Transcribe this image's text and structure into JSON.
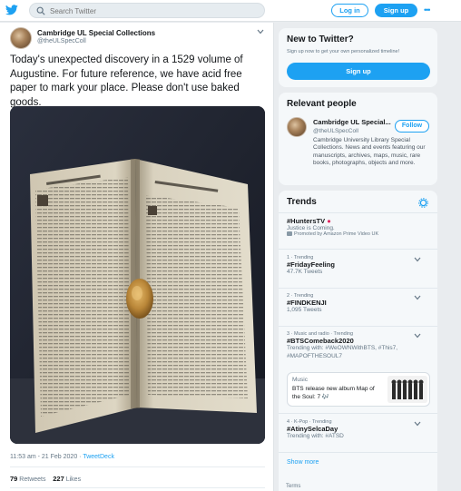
{
  "header": {
    "search_placeholder": "Search Twitter",
    "login_label": "Log in",
    "signup_label": "Sign up"
  },
  "tweet": {
    "author_name": "Cambridge UL Special Collections",
    "author_handle": "@theULSpecColl",
    "text": "Today's unexpected discovery in a 1529 volume of Augustine. For future reference, we have acid free paper to mark your place. Please don't use baked goods.",
    "time": "11:53 am",
    "date": "21 Feb 2020",
    "source": "TweetDeck",
    "retweets_count": "79",
    "retweets_label": "Retweets",
    "likes_count": "227",
    "likes_label": "Likes"
  },
  "new_to_twitter": {
    "title": "New to Twitter?",
    "subtitle": "Sign up now to get your own personalized timeline!",
    "signup_label": "Sign up"
  },
  "relevant_people": {
    "title": "Relevant people",
    "name": "Cambridge UL Special...",
    "handle": "@theULSpecColl",
    "follow_label": "Follow",
    "bio": "Cambridge University Library Special Collections. News and events featuring our manuscripts, archives, maps, music, rare books, photographs, objects and more."
  },
  "trends": {
    "title": "Trends",
    "items": [
      {
        "name": "#HuntersTV",
        "sub": "Justice is Coming.",
        "promo": "Promoted by Amazon Prime Video UK"
      },
      {
        "context": "1 · Trending",
        "name": "#FridayFeeling",
        "sub": "47.7K Tweets"
      },
      {
        "context": "2 · Trending",
        "name": "#FINDKENJI",
        "sub": "1,095 Tweets"
      },
      {
        "context": "3 · Music and radio · Trending",
        "name": "#BTSComeback2020",
        "sub": "Trending with: #WeOWNWithBTS, #This7, #MAPOFTHESOUL7"
      },
      {
        "context": "4 · K-Pop · Trending",
        "name": "#AtinySelcaDay",
        "sub": "Trending with: #ATSD"
      }
    ],
    "music_card": {
      "label": "Music",
      "text": "BTS release new album Map of the Soul: 7 🎶"
    },
    "show_more": "Show more"
  },
  "footer": {
    "terms": "Terms"
  }
}
